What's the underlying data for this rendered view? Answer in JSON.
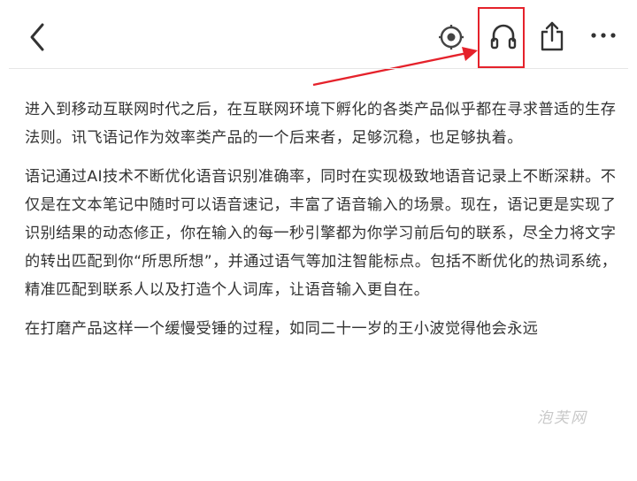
{
  "toolbar": {
    "icons": [
      "back-icon",
      "mark-icon",
      "headphones-icon",
      "share-icon",
      "more-icon"
    ],
    "highlight_color": "#e5222b"
  },
  "article": {
    "paragraphs": [
      "进入到移动互联网时代之后，在互联网环境下孵化的各类产品似乎都在寻求普适的生存法则。讯飞语记作为效率类产品的一个后来者，足够沉稳，也足够执着。",
      "语记通过AI技术不断优化语音识别准确率，同时在实现极致地语音记录上不断深耕。不仅是在文本笔记中随时可以语音速记，丰富了语音输入的场景。现在，语记更是实现了识别结果的动态修正，你在输入的每一秒引擎都为你学习前后句的联系，尽全力将文字的转出匹配到你“所思所想”，并通过语气等加注智能标点。包括不断优化的热词系统，精准匹配到联系人以及打造个人词库，让语音输入更自在。",
      "在打磨产品这样一个缓慢受锤的过程，如同二十一岁的王小波觉得他会永远"
    ]
  },
  "watermark": {
    "text": "泡芙网"
  }
}
